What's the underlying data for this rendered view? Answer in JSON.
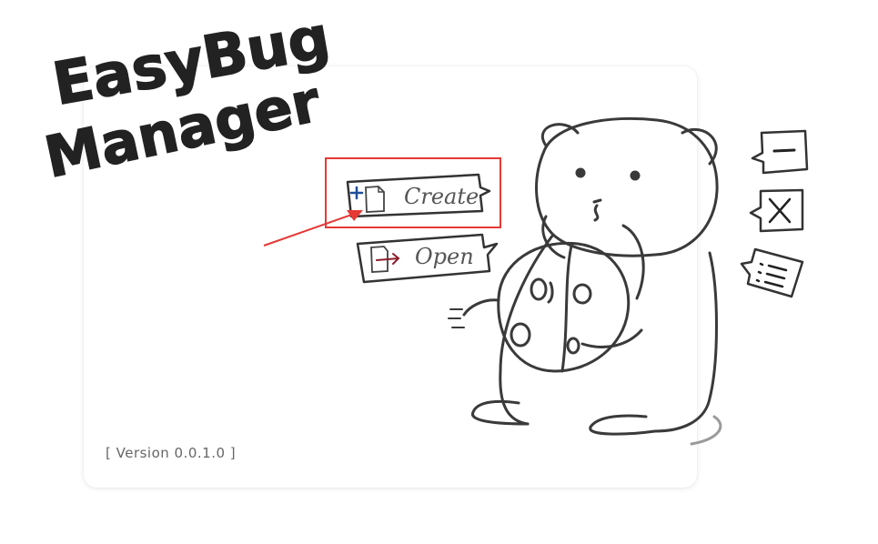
{
  "app": {
    "title_line1": "EasyBug",
    "title_line2": "Manager"
  },
  "buttons": {
    "create_label": "Create",
    "create_icon": "new-file-plus-icon",
    "open_label": "Open",
    "open_icon": "open-file-arrow-icon"
  },
  "window_controls": {
    "minimize_icon": "minimize-icon",
    "close_icon": "close-icon",
    "menu_icon": "menu-list-icon"
  },
  "footer": {
    "version_text": "[ Version 0.0.1.0 ]"
  },
  "annotation": {
    "highlight_color": "#e53935"
  }
}
